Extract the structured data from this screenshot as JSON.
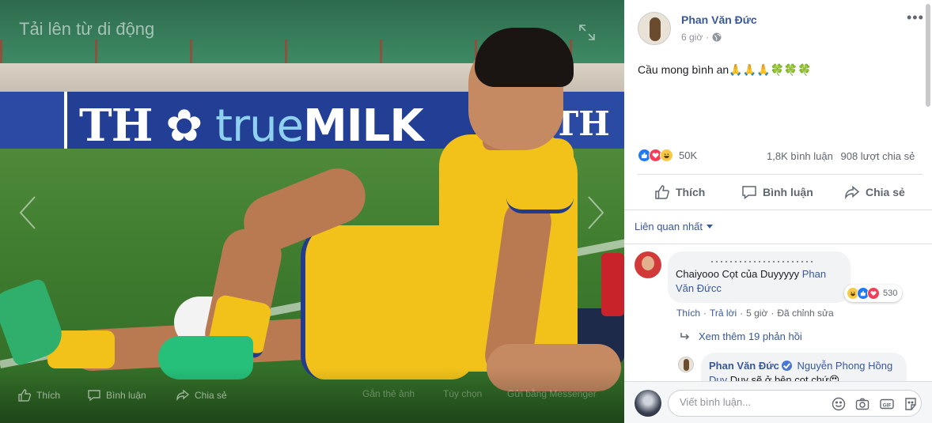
{
  "viewer": {
    "upload_label": "Tải lên từ di động",
    "banner": {
      "brand_prefix": "TH",
      "brand_true": "true",
      "brand_milk": "MILK",
      "brand_right": "TH"
    },
    "bottom_bar": {
      "like": "Thích",
      "comment": "Bình luận",
      "share": "Chia sẻ",
      "tag": "Gắn thẻ ảnh",
      "options": "Tùy chọn",
      "messenger": "Gửi bằng Messenger"
    }
  },
  "post": {
    "author": "Phan Văn Đức",
    "time": "6 giờ",
    "text": "Cầu mong bình an🙏🙏🙏🍀🍀🍀",
    "reaction_count": "50K",
    "comment_count": "1,8K bình luận",
    "share_count": "908 lượt chia sẻ",
    "actions": {
      "like": "Thích",
      "comment": "Bình luận",
      "share": "Chia sẻ"
    },
    "sort_label": "Liên quan nhất"
  },
  "comment": {
    "text": "Chaiyooo Cọt của Duyyyyy ",
    "mention": "Phan Văn Đứcc",
    "reaction_count": "530",
    "meta": {
      "like": "Thích",
      "reply": "Trả lời",
      "time": "5 giờ",
      "edited": "Đã chỉnh sửa"
    },
    "more_replies": "Xem thêm 19 phản hồi"
  },
  "reply": {
    "author": "Phan Văn Đức",
    "mention": "Nguyễn Phong Hồng Duy",
    "text": " Duy sẽ ở bên cọt chứ😍"
  },
  "composer": {
    "placeholder": "Viết bình luận..."
  },
  "colors": {
    "link": "#385898",
    "like_blue": "#2078f4",
    "love_red": "#f33e58",
    "haha_yellow": "#f7c945"
  }
}
